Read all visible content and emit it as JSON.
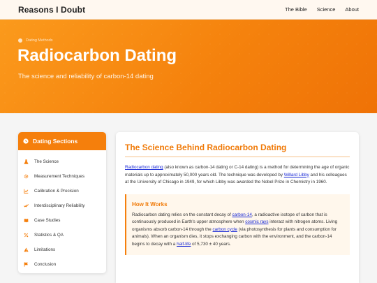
{
  "nav": {
    "brand": "Reasons I Doubt",
    "links": [
      "The Bible",
      "Science",
      "About"
    ]
  },
  "hero": {
    "breadcrumb": "Dating Methods",
    "title": "Radiocarbon Dating",
    "subtitle": "The science and reliability of carbon-14 dating"
  },
  "sidebar": {
    "title": "Dating Sections",
    "items": [
      {
        "label": "The Science",
        "icon": "flask-icon"
      },
      {
        "label": "Measurement Techniques",
        "icon": "gear-icon"
      },
      {
        "label": "Calibration & Precision",
        "icon": "chart-icon"
      },
      {
        "label": "Interdisciplinary Reliability",
        "icon": "check-double-icon"
      },
      {
        "label": "Case Studies",
        "icon": "book-icon"
      },
      {
        "label": "Statistics & QA",
        "icon": "percent-icon"
      },
      {
        "label": "Limitations",
        "icon": "warning-icon"
      },
      {
        "label": "Conclusion",
        "icon": "flag-icon"
      }
    ]
  },
  "main": {
    "title": "The Science Behind Radiocarbon Dating",
    "p1": {
      "link1": "Radiocarbon dating",
      "t1": " (also known as carbon-14 dating or C-14 dating) is a method for determining the age of organic materials up to approximately 50,000 years old. The technique was developed by ",
      "link2": "Willard Libby",
      "t2": " and his colleagues at the University of Chicago in 1949, for which Libby was awarded the Nobel Prize in Chemistry in 1960."
    },
    "how": {
      "title": "How It Works",
      "t1": "Radiocarbon dating relies on the constant decay of ",
      "link1": "carbon-14",
      "t2": ", a radioactive isotope of carbon that is continuously produced in Earth's upper atmosphere when ",
      "link2": "cosmic rays",
      "t3": " interact with nitrogen atoms. Living organisms absorb carbon-14 through the ",
      "link3": "carbon cycle",
      "t4": " (via photosynthesis for plants and consumption for animals). When an organism dies, it stops exchanging carbon with the environment, and the carbon-14 begins to decay with a ",
      "link4": "half-life",
      "t5": " of 5,730 ± 40 years."
    }
  },
  "colors": {
    "accent": "#f57f0c",
    "link": "#1a2ad6"
  }
}
